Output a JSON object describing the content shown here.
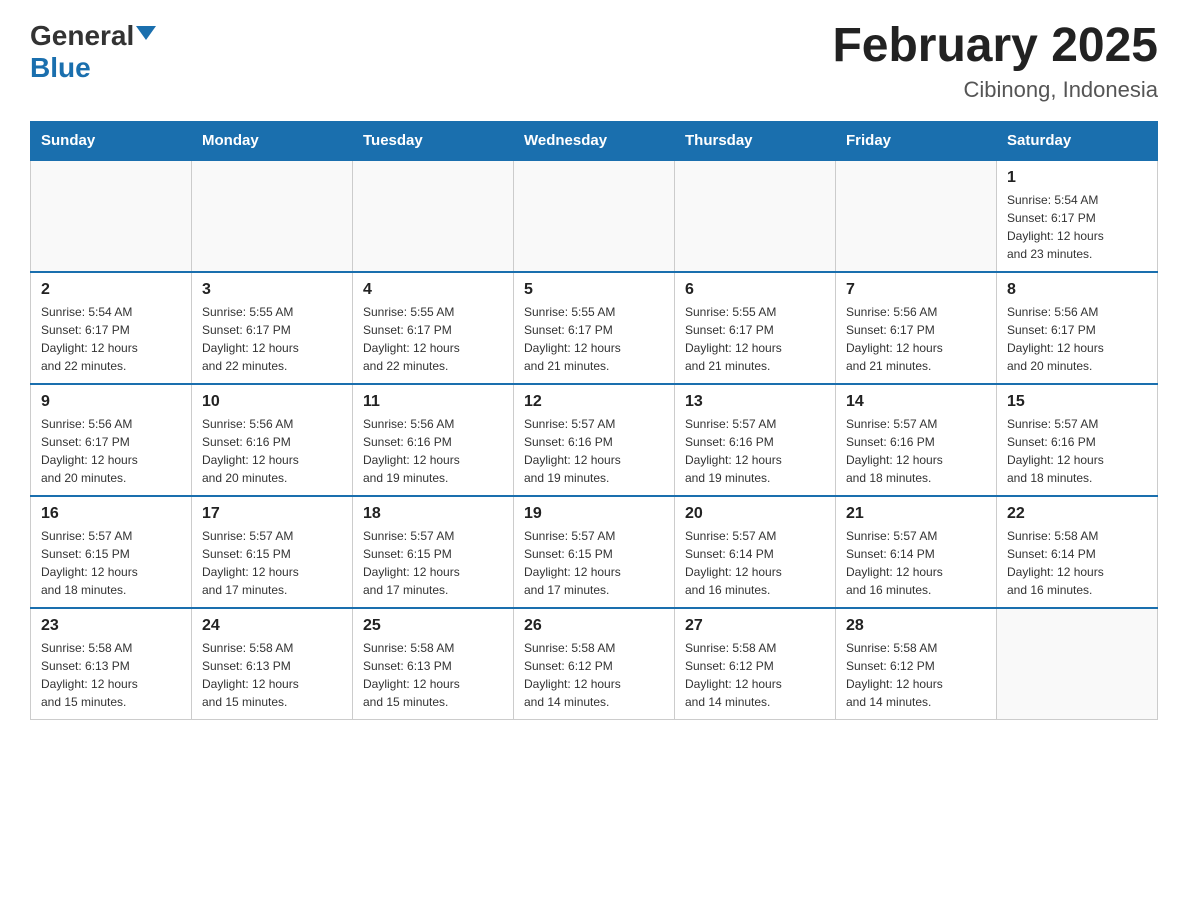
{
  "header": {
    "logo_general": "General",
    "logo_blue": "Blue",
    "title": "February 2025",
    "subtitle": "Cibinong, Indonesia"
  },
  "weekdays": [
    "Sunday",
    "Monday",
    "Tuesday",
    "Wednesday",
    "Thursday",
    "Friday",
    "Saturday"
  ],
  "weeks": [
    [
      {
        "day": "",
        "info": ""
      },
      {
        "day": "",
        "info": ""
      },
      {
        "day": "",
        "info": ""
      },
      {
        "day": "",
        "info": ""
      },
      {
        "day": "",
        "info": ""
      },
      {
        "day": "",
        "info": ""
      },
      {
        "day": "1",
        "info": "Sunrise: 5:54 AM\nSunset: 6:17 PM\nDaylight: 12 hours\nand 23 minutes."
      }
    ],
    [
      {
        "day": "2",
        "info": "Sunrise: 5:54 AM\nSunset: 6:17 PM\nDaylight: 12 hours\nand 22 minutes."
      },
      {
        "day": "3",
        "info": "Sunrise: 5:55 AM\nSunset: 6:17 PM\nDaylight: 12 hours\nand 22 minutes."
      },
      {
        "day": "4",
        "info": "Sunrise: 5:55 AM\nSunset: 6:17 PM\nDaylight: 12 hours\nand 22 minutes."
      },
      {
        "day": "5",
        "info": "Sunrise: 5:55 AM\nSunset: 6:17 PM\nDaylight: 12 hours\nand 21 minutes."
      },
      {
        "day": "6",
        "info": "Sunrise: 5:55 AM\nSunset: 6:17 PM\nDaylight: 12 hours\nand 21 minutes."
      },
      {
        "day": "7",
        "info": "Sunrise: 5:56 AM\nSunset: 6:17 PM\nDaylight: 12 hours\nand 21 minutes."
      },
      {
        "day": "8",
        "info": "Sunrise: 5:56 AM\nSunset: 6:17 PM\nDaylight: 12 hours\nand 20 minutes."
      }
    ],
    [
      {
        "day": "9",
        "info": "Sunrise: 5:56 AM\nSunset: 6:17 PM\nDaylight: 12 hours\nand 20 minutes."
      },
      {
        "day": "10",
        "info": "Sunrise: 5:56 AM\nSunset: 6:16 PM\nDaylight: 12 hours\nand 20 minutes."
      },
      {
        "day": "11",
        "info": "Sunrise: 5:56 AM\nSunset: 6:16 PM\nDaylight: 12 hours\nand 19 minutes."
      },
      {
        "day": "12",
        "info": "Sunrise: 5:57 AM\nSunset: 6:16 PM\nDaylight: 12 hours\nand 19 minutes."
      },
      {
        "day": "13",
        "info": "Sunrise: 5:57 AM\nSunset: 6:16 PM\nDaylight: 12 hours\nand 19 minutes."
      },
      {
        "day": "14",
        "info": "Sunrise: 5:57 AM\nSunset: 6:16 PM\nDaylight: 12 hours\nand 18 minutes."
      },
      {
        "day": "15",
        "info": "Sunrise: 5:57 AM\nSunset: 6:16 PM\nDaylight: 12 hours\nand 18 minutes."
      }
    ],
    [
      {
        "day": "16",
        "info": "Sunrise: 5:57 AM\nSunset: 6:15 PM\nDaylight: 12 hours\nand 18 minutes."
      },
      {
        "day": "17",
        "info": "Sunrise: 5:57 AM\nSunset: 6:15 PM\nDaylight: 12 hours\nand 17 minutes."
      },
      {
        "day": "18",
        "info": "Sunrise: 5:57 AM\nSunset: 6:15 PM\nDaylight: 12 hours\nand 17 minutes."
      },
      {
        "day": "19",
        "info": "Sunrise: 5:57 AM\nSunset: 6:15 PM\nDaylight: 12 hours\nand 17 minutes."
      },
      {
        "day": "20",
        "info": "Sunrise: 5:57 AM\nSunset: 6:14 PM\nDaylight: 12 hours\nand 16 minutes."
      },
      {
        "day": "21",
        "info": "Sunrise: 5:57 AM\nSunset: 6:14 PM\nDaylight: 12 hours\nand 16 minutes."
      },
      {
        "day": "22",
        "info": "Sunrise: 5:58 AM\nSunset: 6:14 PM\nDaylight: 12 hours\nand 16 minutes."
      }
    ],
    [
      {
        "day": "23",
        "info": "Sunrise: 5:58 AM\nSunset: 6:13 PM\nDaylight: 12 hours\nand 15 minutes."
      },
      {
        "day": "24",
        "info": "Sunrise: 5:58 AM\nSunset: 6:13 PM\nDaylight: 12 hours\nand 15 minutes."
      },
      {
        "day": "25",
        "info": "Sunrise: 5:58 AM\nSunset: 6:13 PM\nDaylight: 12 hours\nand 15 minutes."
      },
      {
        "day": "26",
        "info": "Sunrise: 5:58 AM\nSunset: 6:12 PM\nDaylight: 12 hours\nand 14 minutes."
      },
      {
        "day": "27",
        "info": "Sunrise: 5:58 AM\nSunset: 6:12 PM\nDaylight: 12 hours\nand 14 minutes."
      },
      {
        "day": "28",
        "info": "Sunrise: 5:58 AM\nSunset: 6:12 PM\nDaylight: 12 hours\nand 14 minutes."
      },
      {
        "day": "",
        "info": ""
      }
    ]
  ]
}
